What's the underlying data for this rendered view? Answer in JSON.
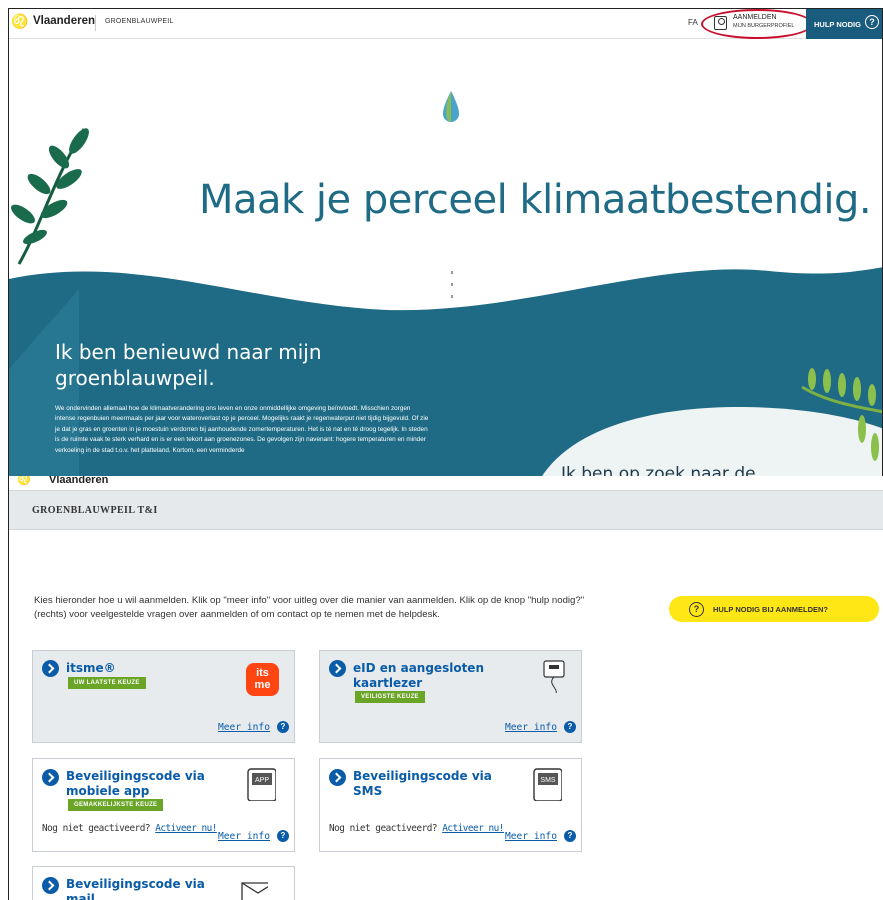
{
  "top": {
    "brand": "Vlaanderen",
    "app_name": "GROENBLAUWPEIL",
    "faq": "FA",
    "login": {
      "line1": "AANMELDEN",
      "line2": "MIJN BURGERPROFIEL"
    },
    "help": {
      "label": "HULP NODIG",
      "icon": "?"
    },
    "hero_title": "Maak je perceel klimaatbestendig.",
    "section_title": "Ik ben benieuwd naar mijn groenblauwpeil.",
    "section_text": "We ondervinden allemaal hoe de klimaatverandering ons leven en onze onmiddellijke omgeving beïnvloedt. Misschien zorgen intense regenbuien meermaals per jaar voor wateroverlast op je perceel. Mogelijks raakt je regenwaterput niet tijdig bijgevuld. Of zie je dat je gras en groenten in je moestuin verdorren bij aanhoudende zomertemperaturen. Het is té nat en té droog tegelijk. In steden is de ruimte vaak te sterk verhard en is er een tekort aan groenezones. De gevolgen zijn navenant: hogere temperaturen en minder verkoeling in de stad t.o.v. het platteland. Kortom, een verminderde",
    "peek_heading": "Ik ben op zoek naar de",
    "colors": {
      "primary": "#1f6b86",
      "help_bg": "#1a5c7e",
      "highlight": "#c8102e"
    }
  },
  "bottom": {
    "brand": "Vlaanderen",
    "bar_title": "GROENBLAUWPEIL T&I",
    "intro": "Kies hieronder hoe u wil aanmelden. Klik op \"meer info\" voor uitleg over die manier van aanmelden. Klik op de knop \"hulp nodig?\" (rechts) voor veelgestelde vragen over aanmelden of om contact op te nemen met de helpdesk.",
    "help_button": "HULP NODIG BIJ AANMELDEN?",
    "help_icon": "?",
    "more_info": "Meer info",
    "not_activated": "Nog niet geactiveerd?",
    "activate": "Activeer nu!",
    "cards": [
      {
        "title": "itsme®",
        "badge": "UW LAATSTE KEUZE",
        "icon": "itsme-logo",
        "logo_text_1": "its",
        "logo_text_2": "me"
      },
      {
        "title": "eID en aangesloten kaartlezer",
        "badge": "VEILIGSTE KEUZE",
        "icon": "card-reader-icon"
      },
      {
        "title": "Beveiligingscode via mobiele app",
        "badge": "GEMAKKELIJKSTE KEUZE",
        "icon": "phone-app-icon",
        "icon_label": "APP"
      },
      {
        "title": "Beveiligingscode via SMS",
        "icon": "phone-sms-icon",
        "icon_label": "SMS"
      },
      {
        "title": "Beveiligingscode via mail",
        "icon": "mail-icon"
      }
    ],
    "colors": {
      "link": "#0a5ca8",
      "badge": "#6aa527",
      "help_btn": "#ffe615",
      "itsme": "#ff4612"
    }
  }
}
